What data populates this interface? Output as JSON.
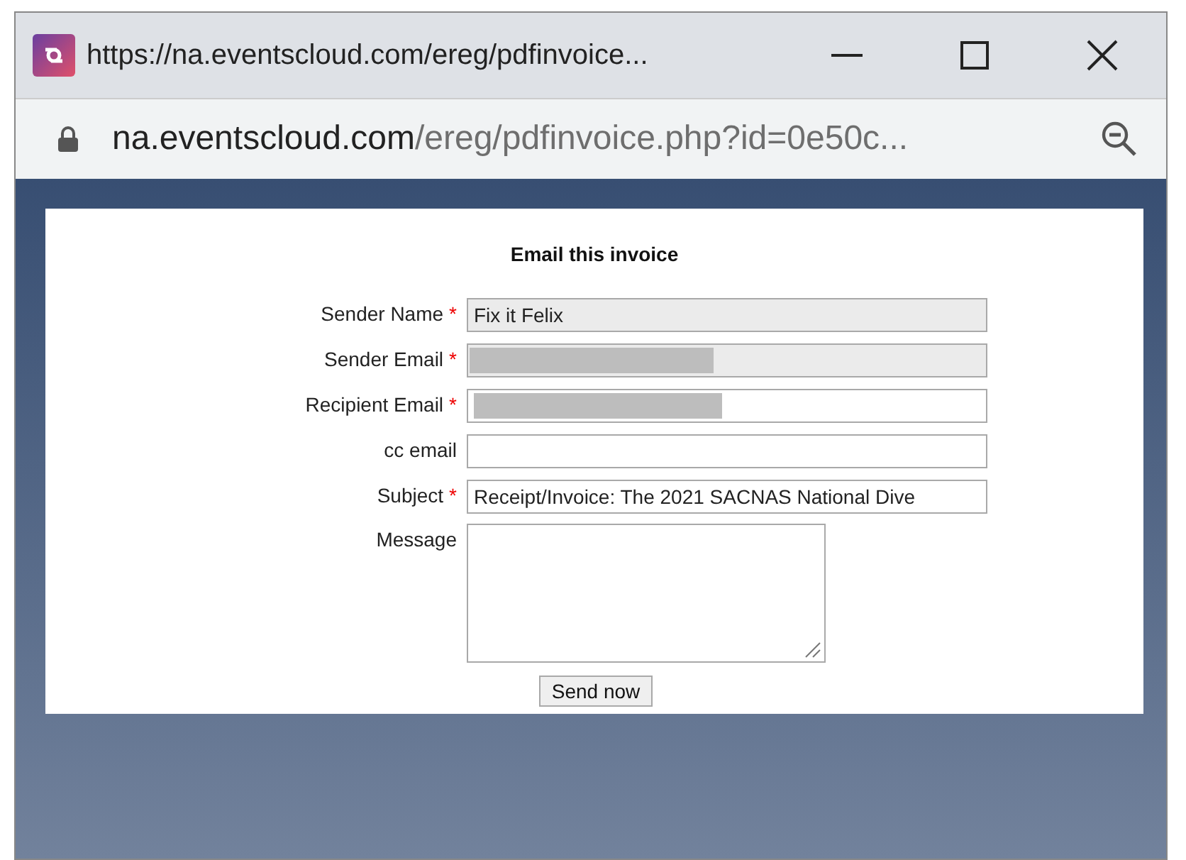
{
  "window": {
    "title": "https://na.eventscloud.com/ereg/pdfinvoice..."
  },
  "address_bar": {
    "domain": "na.eventscloud.com",
    "path": "/ereg/pdfinvoice.php?id=0e50c..."
  },
  "dialog": {
    "title": "Email this invoice",
    "fields": [
      {
        "kind": "input",
        "label": "Sender Name",
        "required_mark": "*",
        "disabled": true,
        "value": "Fix it Felix"
      },
      {
        "kind": "input",
        "label": "Sender Email",
        "required_mark": "*",
        "disabled": true,
        "redacted": true
      },
      {
        "kind": "input",
        "label": "Recipient Email",
        "required_mark": "*",
        "disabled": false,
        "redacted": true
      },
      {
        "kind": "input",
        "label": "cc email",
        "disabled": false
      },
      {
        "kind": "input",
        "label": "Subject",
        "required_mark": "*",
        "disabled": false,
        "value": "Receipt/Invoice: The 2021 SACNAS National Dive"
      },
      {
        "kind": "textarea",
        "label": "Message",
        "disabled": false
      }
    ],
    "button": "Send now"
  }
}
